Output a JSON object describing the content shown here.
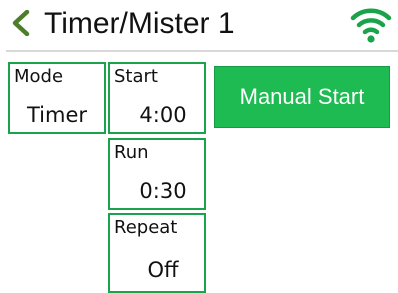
{
  "header": {
    "back_icon": "chevron-left-icon",
    "title": "Timer/Mister 1",
    "wifi_icon": "wifi-icon"
  },
  "settings": {
    "mode": {
      "label": "Mode",
      "value": "Timer"
    },
    "start": {
      "label": "Start",
      "value": "4:00"
    },
    "run": {
      "label": "Run",
      "value": "0:30"
    },
    "repeat": {
      "label": "Repeat",
      "value": "Off"
    }
  },
  "actions": {
    "manual_start": "Manual Start"
  },
  "colors": {
    "accent": "#1dbb52",
    "border": "#1aa34a",
    "back_chevron": "#4e7d2a"
  }
}
